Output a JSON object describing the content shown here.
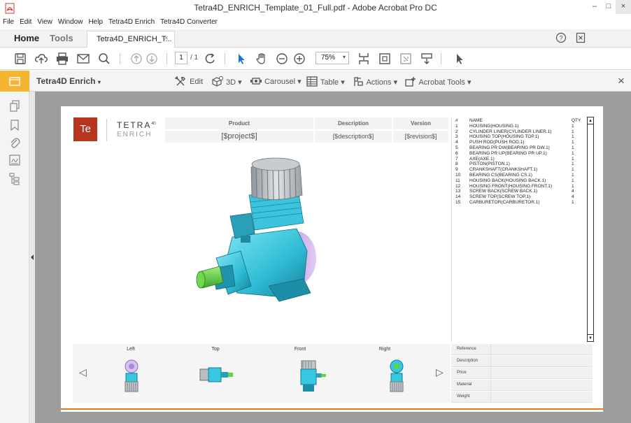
{
  "window": {
    "title": "Tetra4D_ENRICH_Template_01_Full.pdf - Adobe Acrobat Pro DC",
    "controls": [
      "–",
      "□",
      "×"
    ]
  },
  "menu": [
    "File",
    "Edit",
    "View",
    "Window",
    "Help",
    "Tetra4D Enrich",
    "Tetra4D Converter"
  ],
  "tabs": {
    "home": "Home",
    "tools": "Tools",
    "document": "Tetra4D_ENRICH_T...",
    "close": "×"
  },
  "toolbar": {
    "page_current": "1",
    "page_total": "/ 1",
    "zoom": "75%",
    "zoom_caret": "▾"
  },
  "enrich": {
    "title": "Tetra4D Enrich",
    "caret": "▾",
    "tools": [
      {
        "label": "Edit",
        "icon": "wrench-icon"
      },
      {
        "label": "3D ▾",
        "icon": "cube-add-icon"
      },
      {
        "label": "Carousel ▾",
        "icon": "carousel-icon"
      },
      {
        "label": "Table ▾",
        "icon": "table-icon"
      },
      {
        "label": "Actions ▾",
        "icon": "actions-icon"
      },
      {
        "label": "Acrobat Tools ▾",
        "icon": "acrobat-tools-icon"
      }
    ],
    "close": "×"
  },
  "template": {
    "logo_mark": "Te",
    "logo_line1": "TETRA",
    "logo_sup": "4D",
    "logo_line2": "ENRICH",
    "headers": {
      "product": "Product",
      "description": "Description",
      "version": "Version"
    },
    "values": {
      "product": "[$project$]",
      "description": "[$description$]",
      "version": "[$revision$]"
    }
  },
  "bom": {
    "columns": [
      "#",
      "NAME",
      "QTY"
    ],
    "rows": [
      [
        "1",
        "HOUSING(HOUSING.1)",
        "1"
      ],
      [
        "2",
        "CYLINDER LINER(CYLINDER LINER.1)",
        "1"
      ],
      [
        "3",
        "HOUSING TOP(HOUSING TOP.1)",
        "1"
      ],
      [
        "4",
        "PUSH ROD(PUSH ROD.1)",
        "1"
      ],
      [
        "5",
        "BEARING PR DW(BEARING PR DW.1)",
        "1"
      ],
      [
        "6",
        "BEARING PR UP(BEARING PR UP.1)",
        "1"
      ],
      [
        "7",
        "AXE(AXE.1)",
        "1"
      ],
      [
        "8",
        "PISTON(PISTON.1)",
        "1"
      ],
      [
        "9",
        "CRANKSHAFT(CRANKSHAFT.1)",
        "1"
      ],
      [
        "10",
        "BEARING CS(BEARING CS.1)",
        "1"
      ],
      [
        "11",
        "HOUSING BACK(HOUSING BACK.1)",
        "1"
      ],
      [
        "12",
        "HOUSING FRONT(HOUSING FRONT.1)",
        "1"
      ],
      [
        "13",
        "SCREW BACK(SCREW BACK.1)",
        "4"
      ],
      [
        "14",
        "SCREW TOP(SCREW TOP.1)",
        "4"
      ],
      [
        "15",
        "CARBURETOR(CARBURETOR.1)",
        "1"
      ]
    ]
  },
  "carousel": {
    "views": [
      "Left",
      "Top",
      "Front",
      "Right"
    ],
    "prev": "◁",
    "next": "▷"
  },
  "properties": [
    "Reference",
    "Description",
    "Price",
    "Material",
    "Weight"
  ],
  "colors": {
    "accent_orange": "#e87722",
    "logo_red": "#b7351e",
    "enrich_yellow": "#f5b533",
    "model_cyan": "#35c8e0",
    "model_grey": "#b9bfc4",
    "model_green": "#5fd63a",
    "model_purple": "#c6a7e6"
  }
}
